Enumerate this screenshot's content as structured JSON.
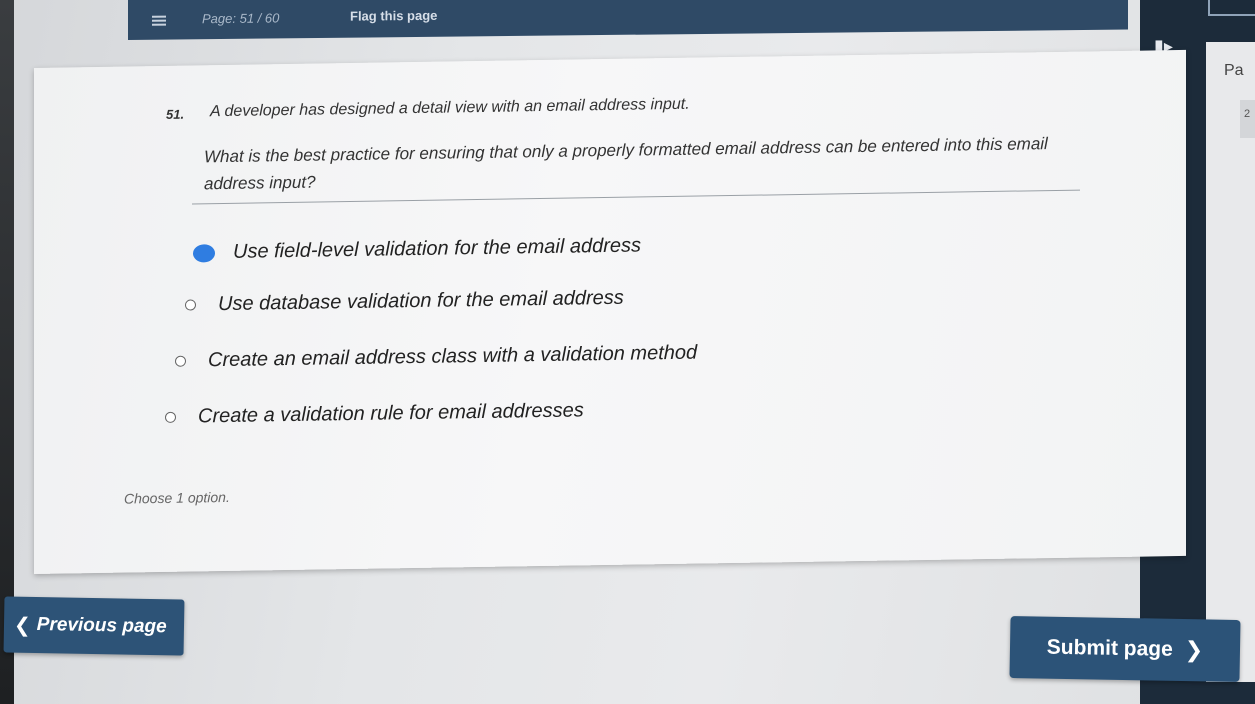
{
  "header": {
    "page_indicator": "Page: 51 / 60",
    "flag_label": "Flag this page"
  },
  "side_panel": {
    "label": "Pa",
    "cell_value": "2"
  },
  "question": {
    "number": "51.",
    "prompt": "A developer has designed a detail view with an email address input.",
    "question_text": "What is the best practice for ensuring that only a properly formatted email address can be entered into this email address input?",
    "options": [
      {
        "label": "Use field-level validation for the email address",
        "selected": true
      },
      {
        "label": "Use database validation for the email address",
        "selected": false
      },
      {
        "label": "Create an email address class with a validation method",
        "selected": false
      },
      {
        "label": "Create a validation rule for email addresses",
        "selected": false
      }
    ],
    "instruction": "Choose 1 option."
  },
  "navigation": {
    "previous_label": "Previous page",
    "submit_label": "Submit page"
  },
  "colors": {
    "header_bg": "#2f4a66",
    "button_bg": "#2c5378",
    "selected_radio": "#2f7de1"
  }
}
